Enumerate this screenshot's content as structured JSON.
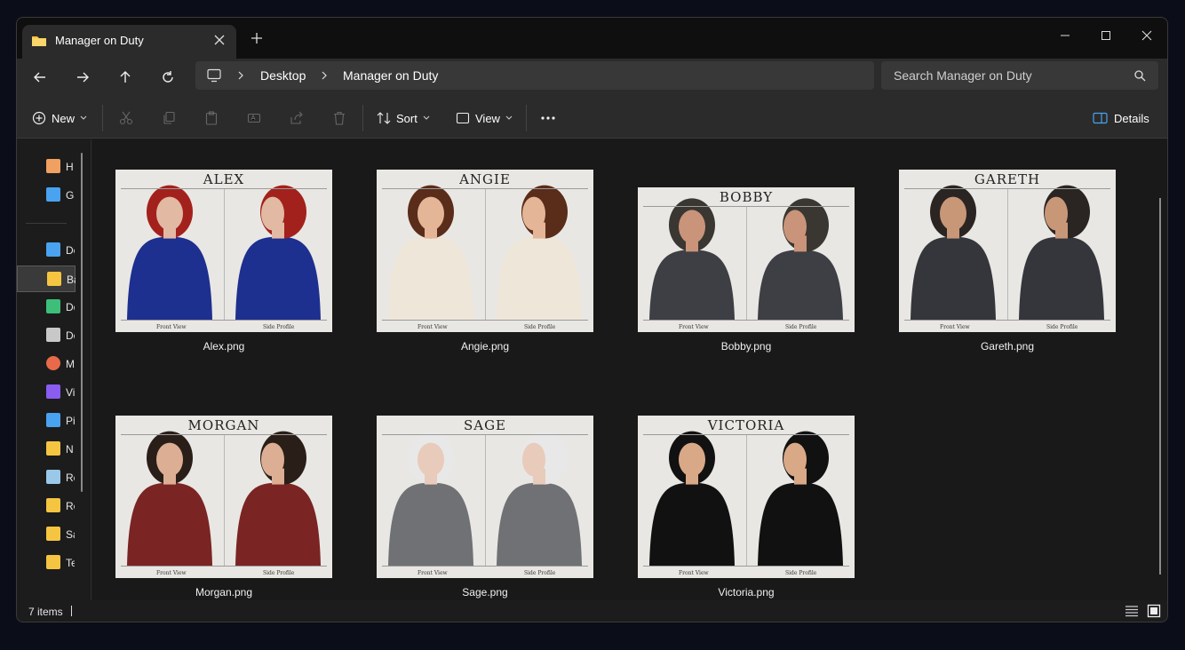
{
  "tab": {
    "title": "Manager on Duty"
  },
  "address": {
    "crumbs": [
      "Desktop",
      "Manager on Duty"
    ]
  },
  "search": {
    "placeholder": "Search Manager on Duty"
  },
  "toolbar": {
    "new": "New",
    "sort": "Sort",
    "view": "View",
    "details": "Details"
  },
  "sidebar": {
    "items": [
      {
        "label": "H",
        "icon": "home-icon"
      },
      {
        "label": "Ga",
        "icon": "gallery-icon"
      },
      {
        "label": "De",
        "icon": "desktop-icon"
      },
      {
        "label": "Ba",
        "icon": "folder-icon",
        "selected": true
      },
      {
        "label": "Do",
        "icon": "download-icon"
      },
      {
        "label": "Do",
        "icon": "documents-icon"
      },
      {
        "label": "M",
        "icon": "music-icon"
      },
      {
        "label": "Vi",
        "icon": "videos-icon"
      },
      {
        "label": "Pi",
        "icon": "pictures-icon"
      },
      {
        "label": "N",
        "icon": "folder-icon"
      },
      {
        "label": "Re",
        "icon": "recycle-bin-icon"
      },
      {
        "label": "Re",
        "icon": "folder-icon"
      },
      {
        "label": "Sa",
        "icon": "folder-icon"
      },
      {
        "label": "Te",
        "icon": "folder-icon"
      }
    ]
  },
  "files": [
    {
      "name": "Alex.png",
      "title": "ALEX",
      "front": "Front View",
      "side": "Side Profile",
      "hair": "#a3211c",
      "shirt": "#1d2f8f",
      "skin": "#e2b9a3"
    },
    {
      "name": "Angie.png",
      "title": "ANGIE",
      "front": "Front View",
      "side": "Side Profile",
      "hair": "#5a2c1a",
      "shirt": "#efe6da",
      "skin": "#e4b596"
    },
    {
      "name": "Bobby.png",
      "title": "BOBBY",
      "front": "Front View",
      "side": "Side Profile",
      "hair": "#3a3632",
      "shirt": "#3d3f44",
      "skin": "#c99479"
    },
    {
      "name": "Gareth.png",
      "title": "GARETH",
      "front": "Front View",
      "side": "Side Profile",
      "hair": "#2a2522",
      "shirt": "#34363b",
      "skin": "#c89778"
    },
    {
      "name": "Morgan.png",
      "title": "MORGAN",
      "front": "Front View",
      "side": "Side Profile",
      "hair": "#2a1e18",
      "shirt": "#7a2424",
      "skin": "#dcae93"
    },
    {
      "name": "Sage.png",
      "title": "SAGE",
      "front": "Front View",
      "side": "Side Profile",
      "hair": "#e8e8e8",
      "shirt": "#6f7174",
      "skin": "#e8cbbb"
    },
    {
      "name": "Victoria.png",
      "title": "VICTORIA",
      "front": "Front View",
      "side": "Side Profile",
      "hair": "#111111",
      "shirt": "#111111",
      "skin": "#d9a887"
    }
  ],
  "status": {
    "count": "7 items"
  },
  "colors": {
    "folder": "#f5c542",
    "accent": "#4aa3f0"
  }
}
